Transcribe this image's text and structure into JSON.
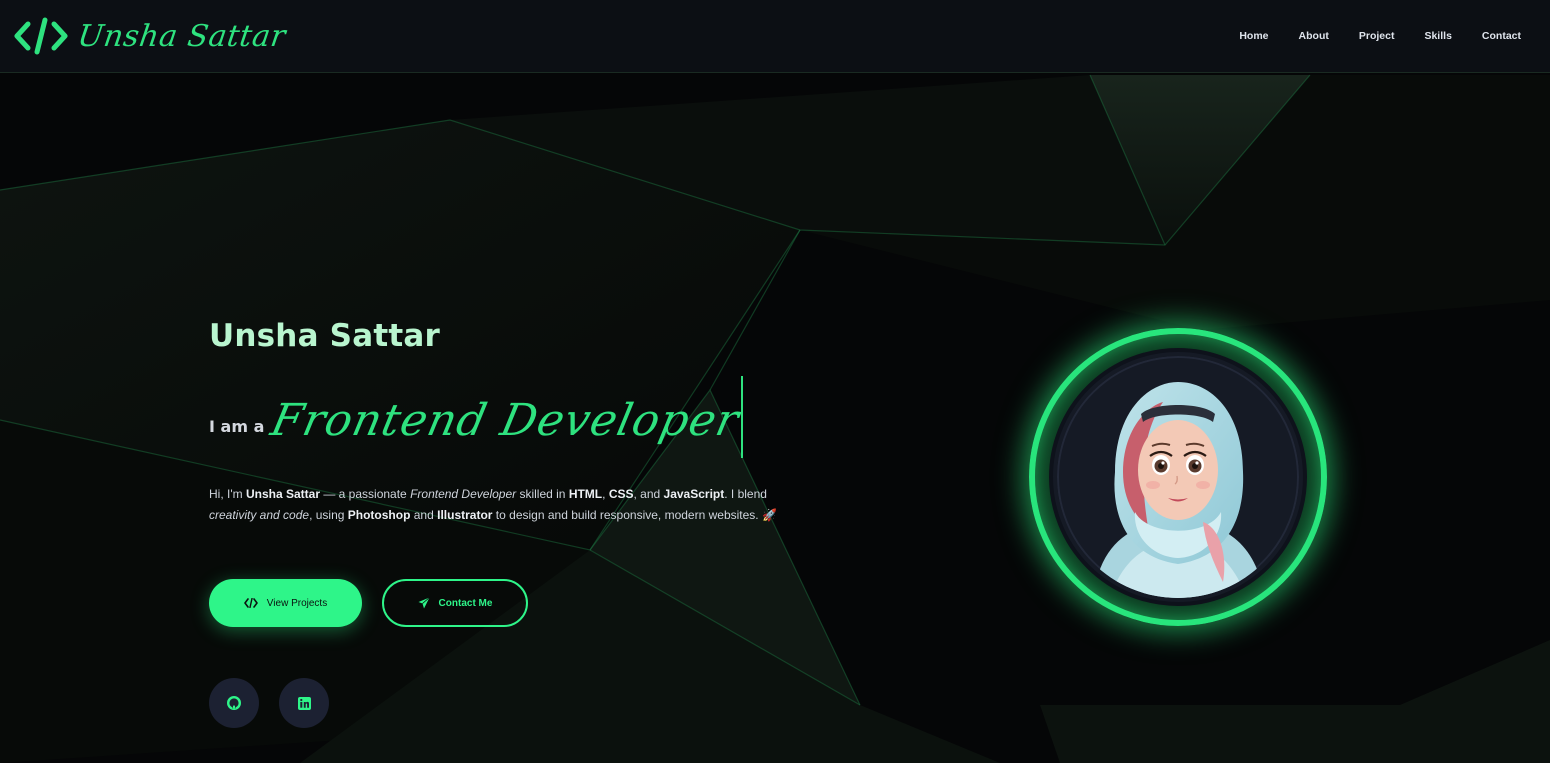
{
  "brand": {
    "name": "Unsha Sattar"
  },
  "nav": {
    "items": [
      "Home",
      "About",
      "Project",
      "Skills",
      "Contact"
    ]
  },
  "hero": {
    "name": "Unsha Sattar",
    "role_prefix": "I am a",
    "role_typed": "Frontend Developer",
    "bio": {
      "p1": "Hi, I'm ",
      "name": "Unsha Sattar",
      "p2": " — a passionate ",
      "role": "Frontend Developer",
      "p3": " skilled in ",
      "html": "HTML",
      "p4": ", ",
      "css": "CSS",
      "p5": ", and ",
      "js": "JavaScript",
      "p6": ". I blend ",
      "creativity": "creativity and code",
      "p7": ", using ",
      "photoshop": "Photoshop",
      "p8": " and ",
      "illustrator": "Illustrator",
      "p9": " to design and build responsive, modern websites. 🚀"
    },
    "buttons": {
      "projects": "View Projects",
      "contact": "Contact Me"
    }
  },
  "socials": {
    "icons": [
      "github-icon",
      "linkedin-icon"
    ]
  },
  "colors": {
    "accent": "#2ef589",
    "background": "#050607",
    "header": "#0c0f14"
  }
}
